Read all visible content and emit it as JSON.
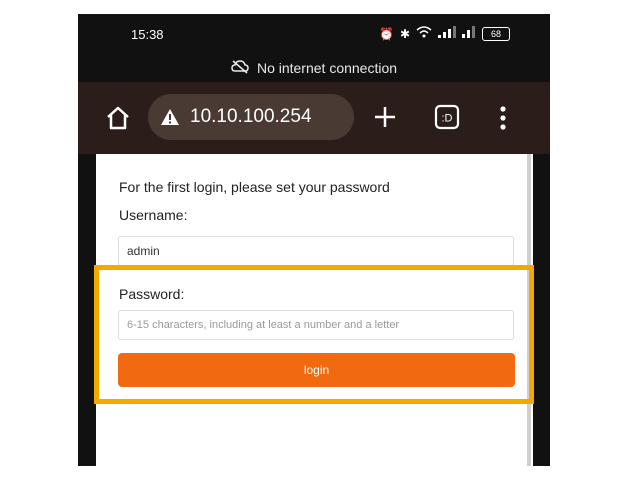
{
  "status_bar": {
    "time": "15:38",
    "battery": "68"
  },
  "network_banner": {
    "text": "No internet connection"
  },
  "browser": {
    "url": "10.10.100.254",
    "tabs_icon_text": ":D"
  },
  "form": {
    "intro": "For the first login, please set your password",
    "username_label": "Username:",
    "username_value": "admin",
    "password_label": "Password:",
    "password_placeholder": "6-15 characters, including at least a number and a letter",
    "login_label": "login"
  },
  "colors": {
    "toolbar_bg": "#2b1e1a",
    "url_bg": "#4a3a34",
    "login_button": "#f26a10",
    "highlight": "#f2a900"
  }
}
